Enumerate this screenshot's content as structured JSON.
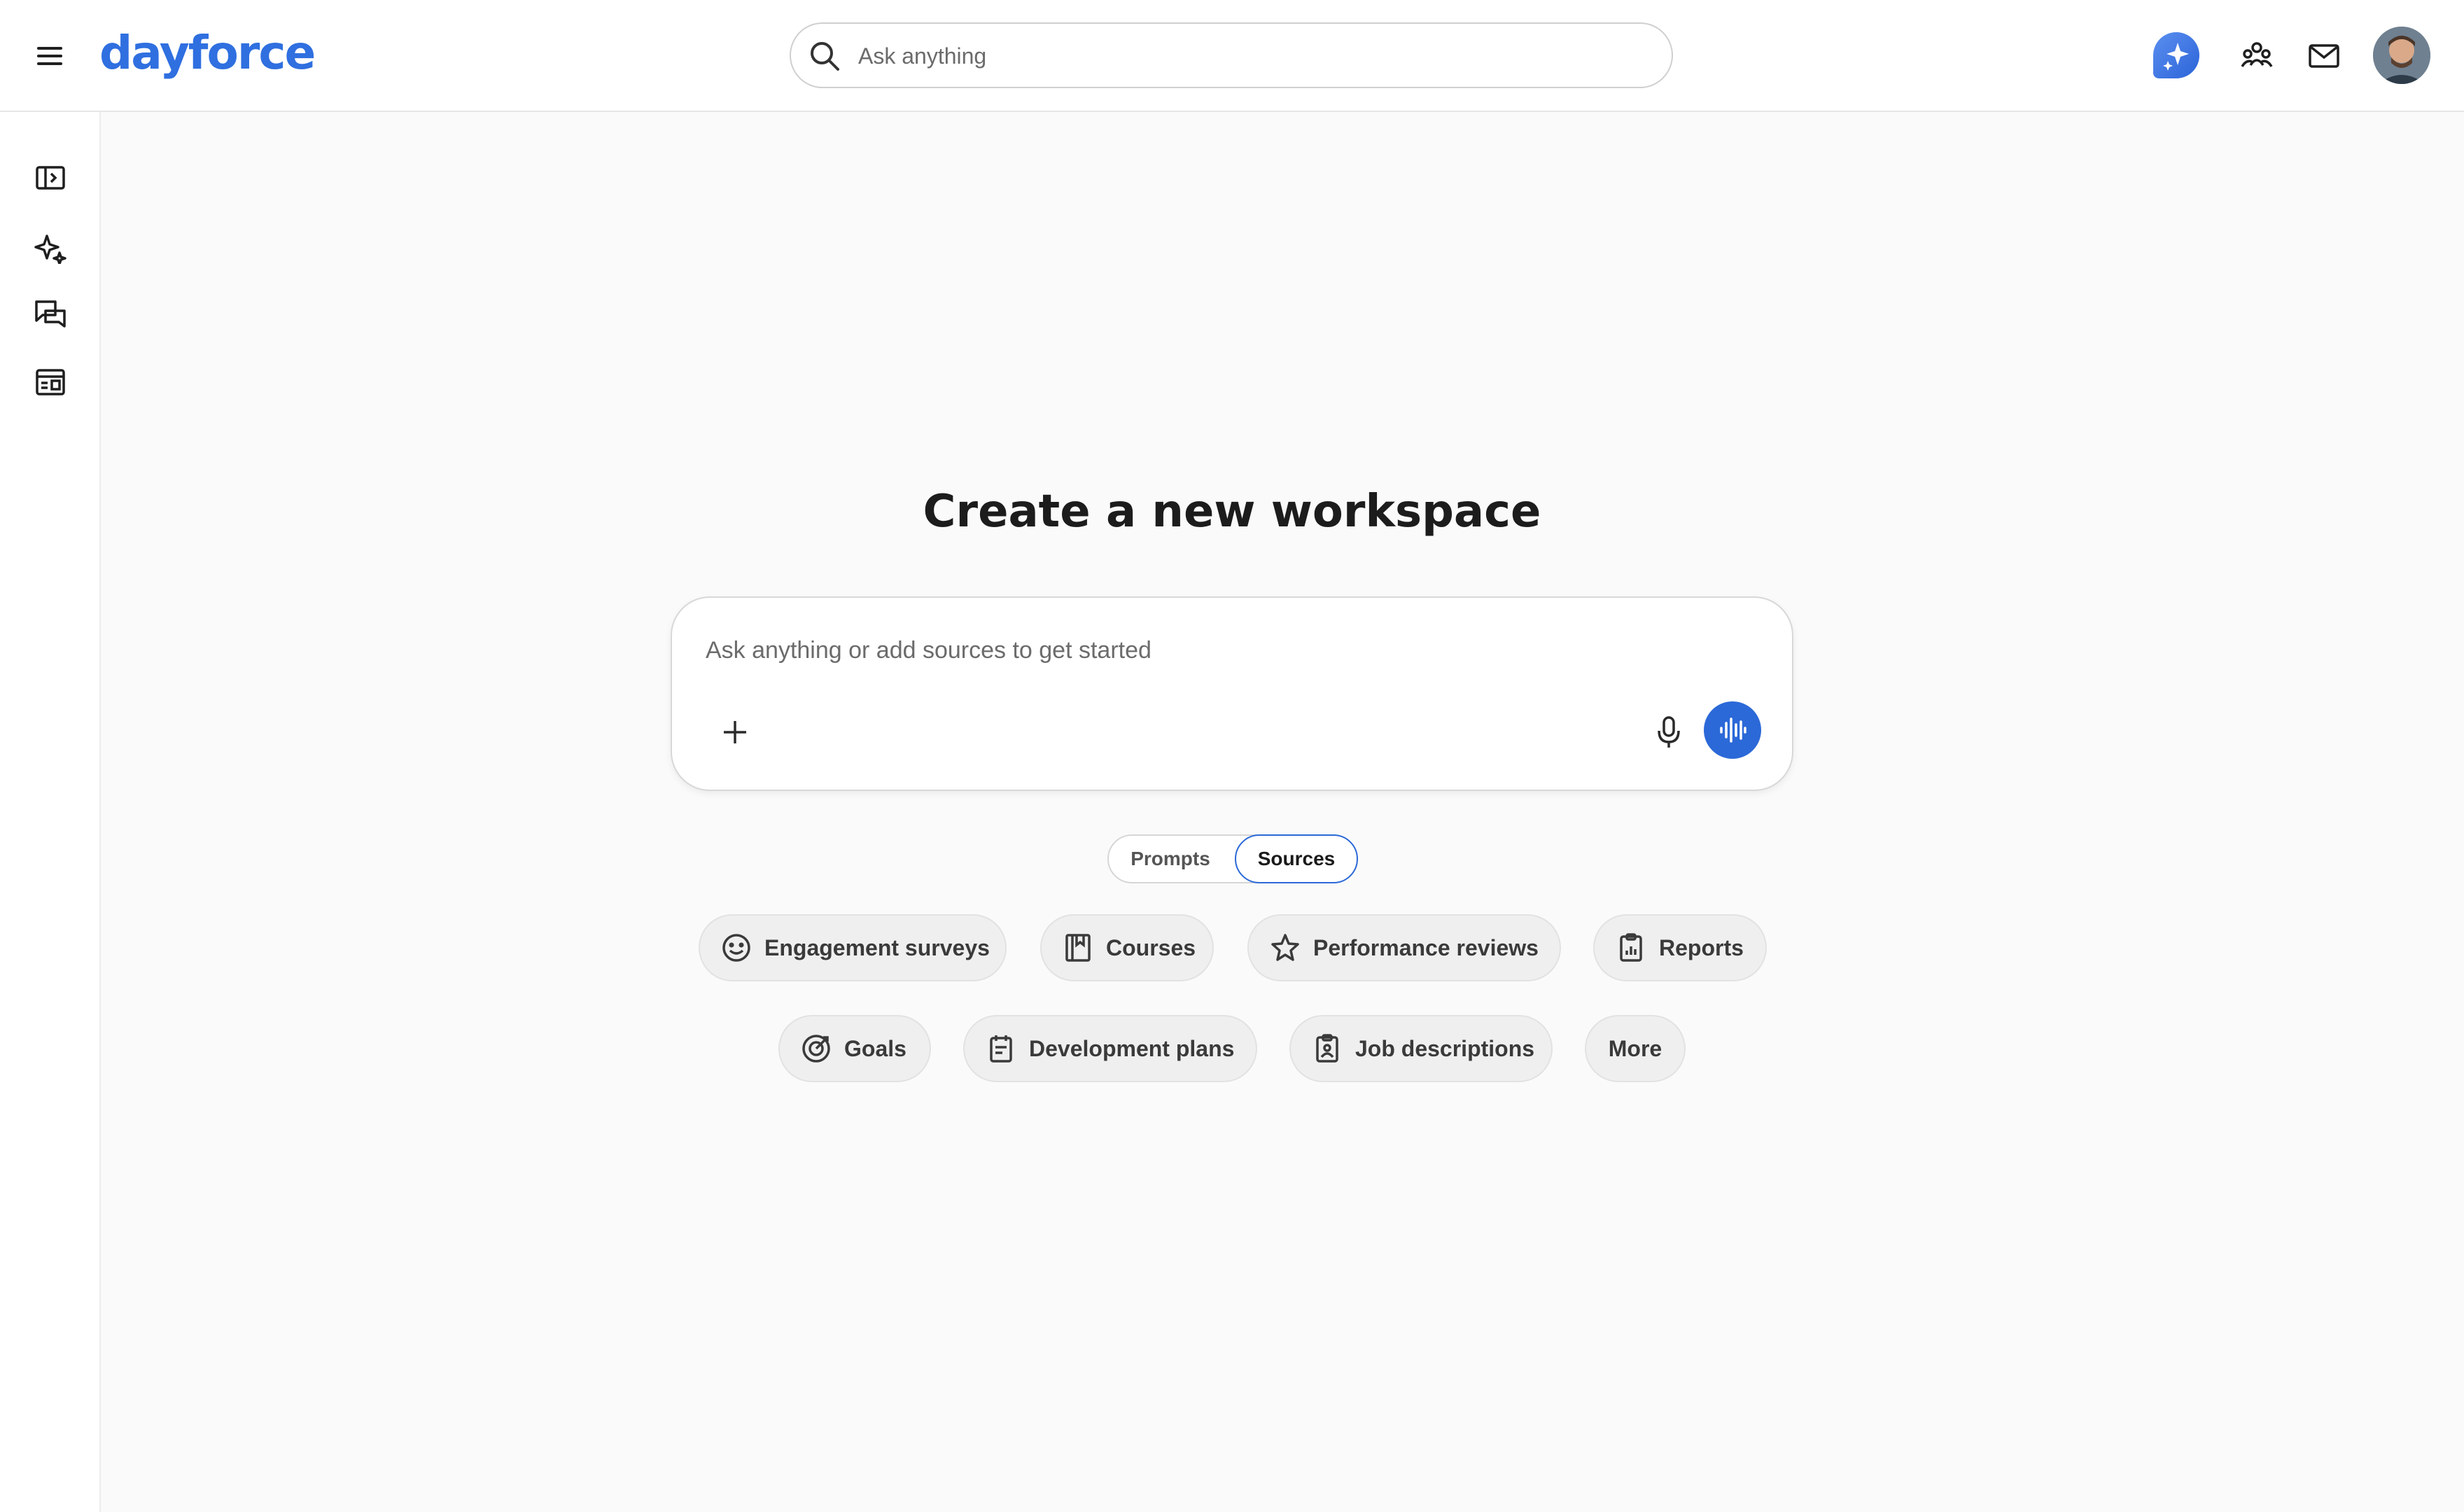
{
  "header": {
    "logo_text": "dayforce",
    "search_placeholder": "Ask anything"
  },
  "main": {
    "heading": "Create a new workspace",
    "composer_placeholder": "Ask anything or add sources to get started",
    "toggle": {
      "prompts": "Prompts",
      "sources": "Sources",
      "selected": "Sources"
    },
    "chips_row1": [
      {
        "label": "Engagement surveys",
        "icon": "smile-icon"
      },
      {
        "label": "Courses",
        "icon": "book-icon"
      },
      {
        "label": "Performance reviews",
        "icon": "star-icon"
      },
      {
        "label": "Reports",
        "icon": "clipboard-report-icon"
      }
    ],
    "chips_row2": [
      {
        "label": "Goals",
        "icon": "target-icon"
      },
      {
        "label": "Development plans",
        "icon": "calendar-clipboard-icon"
      },
      {
        "label": "Job descriptions",
        "icon": "badge-clipboard-icon"
      },
      {
        "label": "More",
        "icon": ""
      }
    ]
  },
  "colors": {
    "brand": "#2f6fe0",
    "accent": "#2b69d8",
    "background": "#fafafa"
  }
}
